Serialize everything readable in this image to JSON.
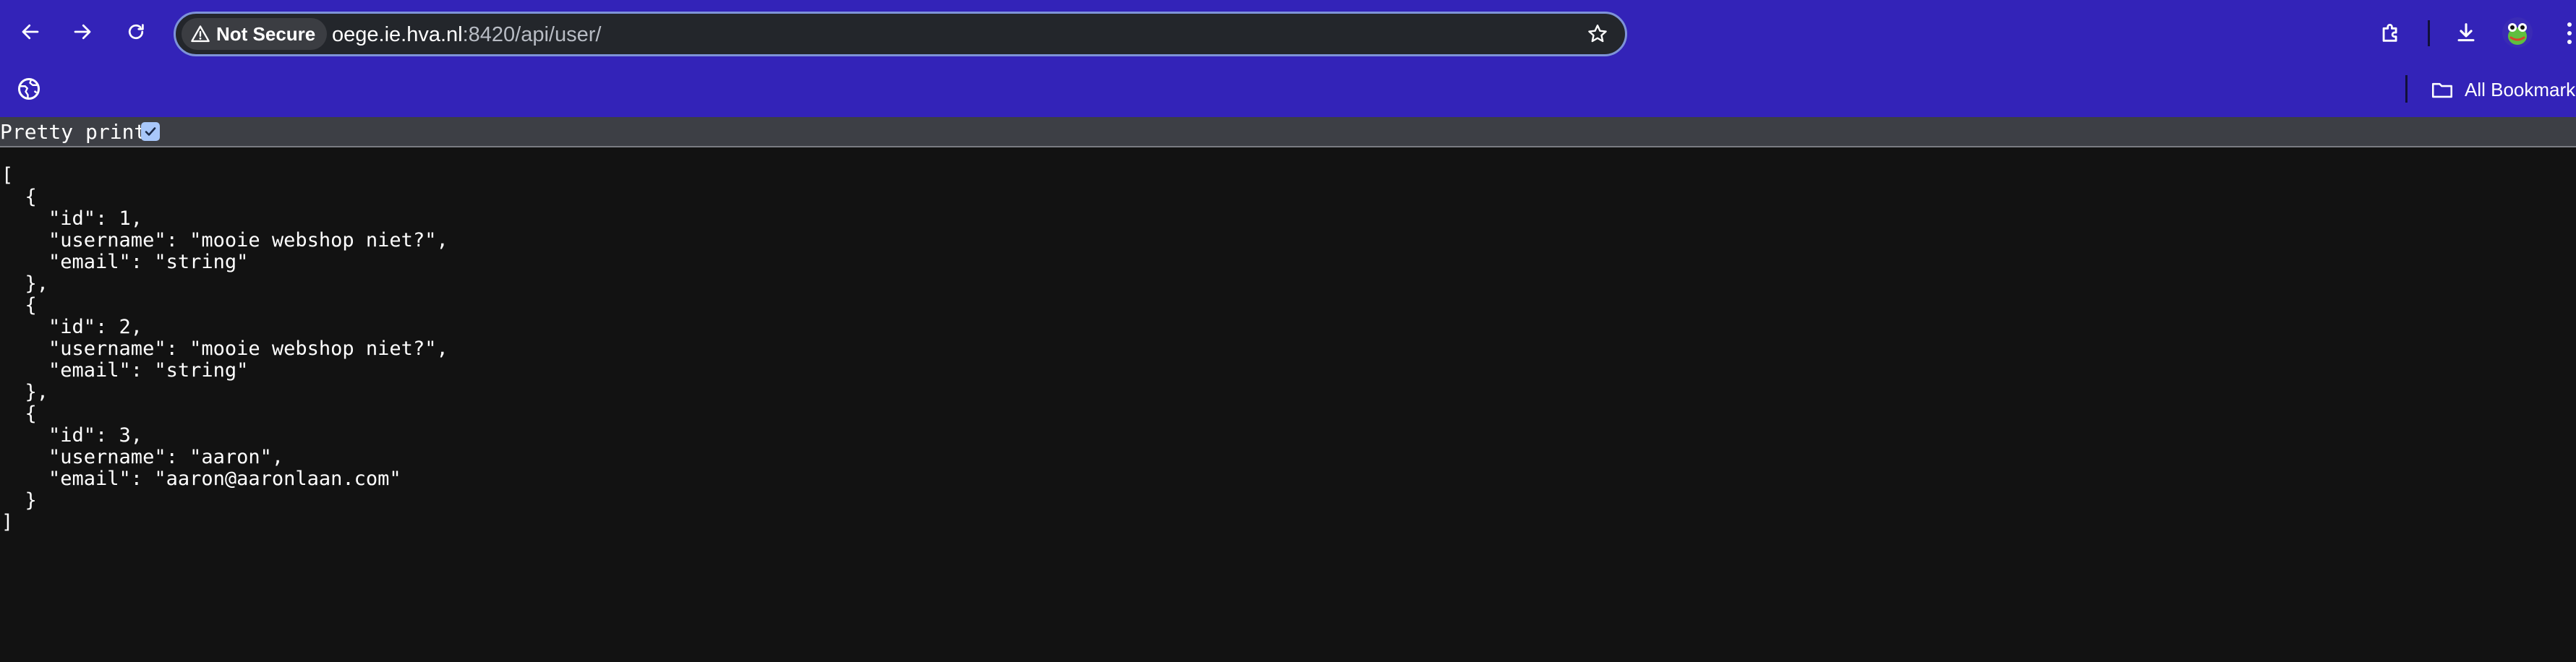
{
  "browser": {
    "security_label": "Not Secure",
    "url_host": "oege.ie.hva.nl",
    "url_rest": ":8420/api/user/",
    "bookmarks": {
      "all_bookmarks_label": "All Bookmarks"
    },
    "icons": {
      "back": "arrow-left-icon",
      "forward": "arrow-right-icon",
      "reload": "reload-icon",
      "security": "warning-triangle-icon",
      "bookmark_star": "star-icon",
      "extensions": "puzzle-icon",
      "downloads": "download-icon",
      "profile": "avatar",
      "menu": "more-vertical-icon",
      "bookmark_site": "globe-icon",
      "bookmarks_folder": "folder-icon"
    },
    "colors": {
      "theme": "#3323b8",
      "omnibox": "#23262b",
      "omnibox_border": "#7e93d8",
      "page_background": "#121212"
    }
  },
  "page": {
    "pretty_print_label": "Pretty print",
    "pretty_print_checked": true,
    "json_lines": [
      "[",
      "  {",
      "    \"id\": 1,",
      "    \"username\": \"mooie webshop niet?\",",
      "    \"email\": \"string\"",
      "  },",
      "  {",
      "    \"id\": 2,",
      "    \"username\": \"mooie webshop niet?\",",
      "    \"email\": \"string\"",
      "  },",
      "  {",
      "    \"id\": 3,",
      "    \"username\": \"aaron\",",
      "    \"email\": \"aaron@aaronlaan.com\"",
      "  }",
      "]"
    ]
  }
}
